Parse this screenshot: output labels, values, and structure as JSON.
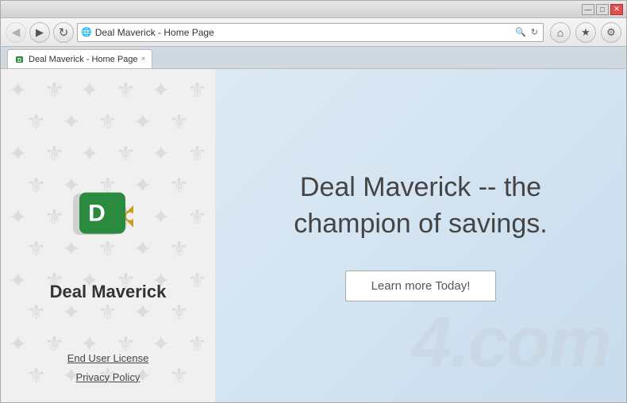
{
  "window": {
    "title_bar_buttons": {
      "minimize": "—",
      "maximize": "□",
      "close": "✕"
    }
  },
  "browser": {
    "back_btn": "◀",
    "forward_btn": "▶",
    "refresh_btn": "↻",
    "address": "Deal Maverick - Home Page",
    "address_placeholder": "Deal Maverick - Home Page",
    "favicon": "D",
    "tab_title": "Deal Maverick - Home Page",
    "tab_close": "×",
    "bookmarks": {
      "home_icon": "⌂",
      "star_icon": "★",
      "settings_icon": "⚙"
    }
  },
  "left_panel": {
    "logo_letter": "D",
    "app_name": "Deal Maverick",
    "links": [
      {
        "label": "End User License"
      },
      {
        "label": "Privacy Policy"
      }
    ]
  },
  "right_panel": {
    "headline_line1": "Deal Maverick -- the",
    "headline_line2": "champion of savings.",
    "cta_button": "Learn more Today!",
    "watermark": "4.com"
  }
}
